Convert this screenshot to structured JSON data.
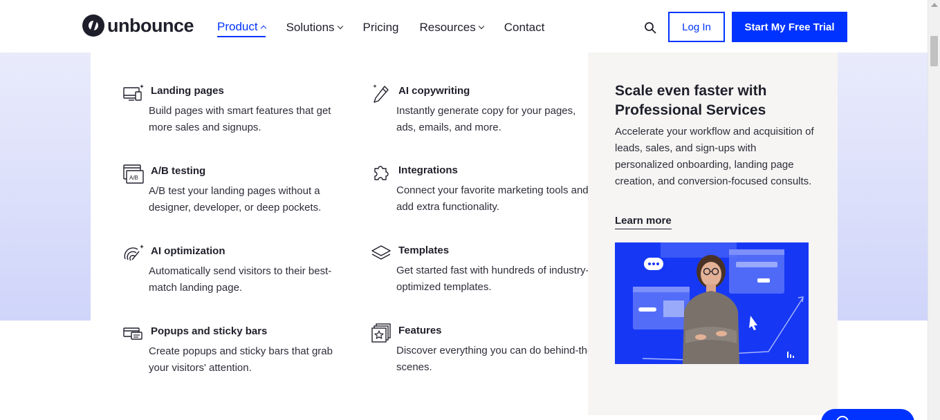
{
  "header": {
    "logo_text": "unbounce",
    "nav": [
      {
        "label": "Product",
        "has_caret": true,
        "active": true
      },
      {
        "label": "Solutions",
        "has_caret": true,
        "active": false
      },
      {
        "label": "Pricing",
        "has_caret": false,
        "active": false
      },
      {
        "label": "Resources",
        "has_caret": true,
        "active": false
      },
      {
        "label": "Contact",
        "has_caret": false,
        "active": false
      }
    ],
    "login_label": "Log In",
    "trial_label": "Start My Free Trial"
  },
  "menu": {
    "items": [
      {
        "icon": "landing-pages-icon",
        "title": "Landing pages",
        "desc": "Build pages with smart features that get more sales and signups."
      },
      {
        "icon": "ab-testing-icon",
        "title": "A/B testing",
        "desc": "A/B test your landing pages without a designer, developer, or deep pockets."
      },
      {
        "icon": "ai-optimization-icon",
        "title": "AI optimization",
        "desc": "Automatically send visitors to their best-match landing page."
      },
      {
        "icon": "popups-icon",
        "title": "Popups and sticky bars",
        "desc": "Create popups and sticky bars that grab your visitors' attention."
      },
      {
        "icon": "ai-copywriting-icon",
        "title": "AI copywriting",
        "desc": "Instantly generate copy for your pages, ads, emails, and more."
      },
      {
        "icon": "integrations-icon",
        "title": "Integrations",
        "desc": "Connect your favorite marketing tools and add extra functionality."
      },
      {
        "icon": "templates-icon",
        "title": "Templates",
        "desc": "Get started fast with hundreds of industry-optimized templates."
      },
      {
        "icon": "features-icon",
        "title": "Features",
        "desc": "Discover everything you can do behind-the-scenes."
      }
    ]
  },
  "promo": {
    "title": "Scale even faster with Professional Services",
    "desc": "Accelerate your workflow and acquisition of leads, sales, and sign-ups with personalized onboarding, landing page creation, and conversion-focused consults.",
    "link": "Learn more"
  },
  "colors": {
    "accent": "#0033ff",
    "text": "#1f1f2b",
    "promo_bg": "#f6f5f4"
  }
}
